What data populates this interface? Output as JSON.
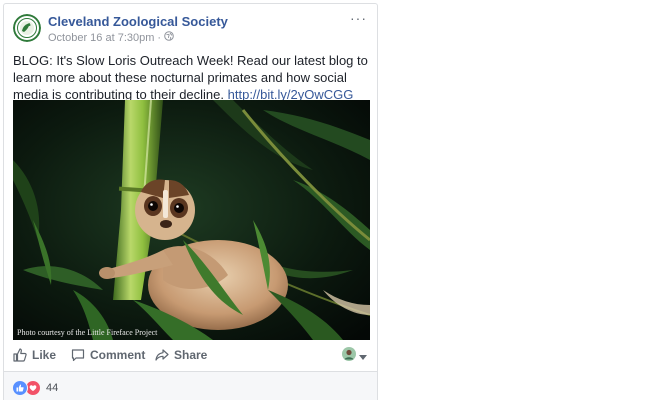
{
  "post": {
    "page_name": "Cleveland Zoological Society",
    "timestamp": "October 16 at 7:30pm",
    "separator": "·",
    "audience_icon": "globe-icon",
    "more_icon": "more-options-icon",
    "more_label": "···",
    "text": "BLOG: It's Slow Loris Outreach Week! Read our latest blog to learn more about these nocturnal primates and how social media is contributing to their decline.",
    "link": "http://bit.ly/2yOwCGG",
    "photo_credit": "Photo courtesy of the Little Fireface Project"
  },
  "actions": {
    "like_label": "Like",
    "comment_label": "Comment",
    "share_label": "Share"
  },
  "reactions": {
    "count": "44",
    "types": [
      "like",
      "love"
    ]
  },
  "colors": {
    "link_blue": "#365899",
    "meta_gray": "#90949c",
    "action_gray": "#606770",
    "like_blue": "#5890ff",
    "love_red": "#f25268",
    "logo_green": "#2f7a3a"
  }
}
